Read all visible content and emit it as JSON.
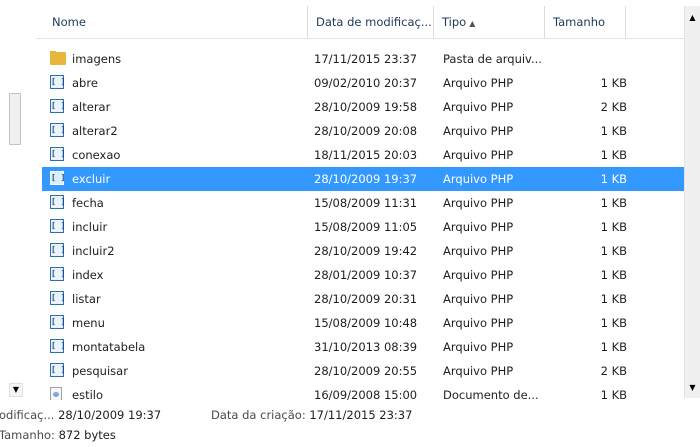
{
  "columns": {
    "name": "Nome",
    "date": "Data de modificaç...",
    "type": "Tipo",
    "size": "Tamanho"
  },
  "files": [
    {
      "name": "imagens",
      "date": "17/11/2015 23:37",
      "type": "Pasta de arquiv...",
      "size": "",
      "icon": "folder-icon"
    },
    {
      "name": "abre",
      "date": "09/02/2010 20:37",
      "type": "Arquivo PHP",
      "size": "1 KB",
      "icon": "php-file-icon"
    },
    {
      "name": "alterar",
      "date": "28/10/2009 19:58",
      "type": "Arquivo PHP",
      "size": "2 KB",
      "icon": "php-file-icon"
    },
    {
      "name": "alterar2",
      "date": "28/10/2009 20:08",
      "type": "Arquivo PHP",
      "size": "1 KB",
      "icon": "php-file-icon"
    },
    {
      "name": "conexao",
      "date": "18/11/2015 20:03",
      "type": "Arquivo PHP",
      "size": "1 KB",
      "icon": "php-file-icon"
    },
    {
      "name": "excluir",
      "date": "28/10/2009 19:37",
      "type": "Arquivo PHP",
      "size": "1 KB",
      "icon": "php-file-icon",
      "selected": true
    },
    {
      "name": "fecha",
      "date": "15/08/2009 11:31",
      "type": "Arquivo PHP",
      "size": "1 KB",
      "icon": "php-file-icon"
    },
    {
      "name": "incluir",
      "date": "15/08/2009 11:05",
      "type": "Arquivo PHP",
      "size": "1 KB",
      "icon": "php-file-icon"
    },
    {
      "name": "incluir2",
      "date": "28/10/2009 19:42",
      "type": "Arquivo PHP",
      "size": "1 KB",
      "icon": "php-file-icon"
    },
    {
      "name": "index",
      "date": "28/01/2009 10:37",
      "type": "Arquivo PHP",
      "size": "1 KB",
      "icon": "php-file-icon"
    },
    {
      "name": "listar",
      "date": "28/10/2009 20:31",
      "type": "Arquivo PHP",
      "size": "1 KB",
      "icon": "php-file-icon"
    },
    {
      "name": "menu",
      "date": "15/08/2009 10:48",
      "type": "Arquivo PHP",
      "size": "1 KB",
      "icon": "php-file-icon"
    },
    {
      "name": "montatabela",
      "date": "31/10/2013 08:39",
      "type": "Arquivo PHP",
      "size": "1 KB",
      "icon": "php-file-icon"
    },
    {
      "name": "pesquisar",
      "date": "28/10/2009 20:55",
      "type": "Arquivo PHP",
      "size": "2 KB",
      "icon": "php-file-icon"
    },
    {
      "name": "estilo",
      "date": "16/09/2008 15:00",
      "type": "Documento de...",
      "size": "1 KB",
      "icon": "css-file-icon"
    }
  ],
  "details": {
    "modified_label": "odificaç...",
    "modified_value": "28/10/2009 19:37",
    "created_label": "Data da criação:",
    "created_value": "17/11/2015 23:37",
    "size_label": "Tamanho:",
    "size_value": "872 bytes"
  },
  "colors": {
    "selection": "#3399ff",
    "folder": "#e8b63d",
    "php_icon": "#2a6fb5"
  }
}
